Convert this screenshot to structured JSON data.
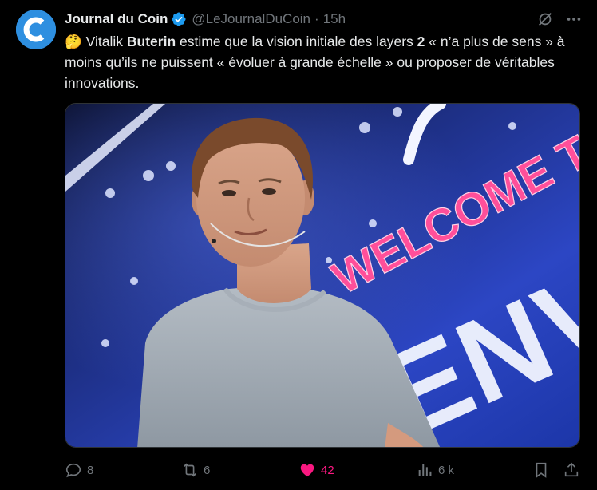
{
  "account": {
    "display_name": "Journal du Coin",
    "handle": "@LeJournalDuCoin",
    "separator": "·",
    "time": "15h",
    "avatar_letter": "C"
  },
  "tweet": {
    "emoji": "🤔",
    "text_1": " Vitalik ",
    "bold_1": "Buterin",
    "text_2": " estime que la vision initiale des layers ",
    "bold_2": "2",
    "text_3": " « n’a plus de sens » à moins qu’ils ne puissent « évoluer à grande échelle » ou proposer de véritables innovations."
  },
  "media": {
    "sign_text_1": "WELCOME TO",
    "sign_text_2": "ENV"
  },
  "actions": {
    "replies": "8",
    "reposts": "6",
    "likes": "42",
    "views": "6 k"
  },
  "colors": {
    "background": "#000000",
    "text": "#e7e9ea",
    "muted": "#71767b",
    "like_active": "#f91880",
    "verified": "#1d9bf0",
    "avatar": "#2e8fe0"
  },
  "icons": [
    "verified-badge-icon",
    "grok-icon",
    "more-icon",
    "reply-icon",
    "repost-icon",
    "like-icon",
    "views-icon",
    "bookmark-icon",
    "share-icon"
  ]
}
